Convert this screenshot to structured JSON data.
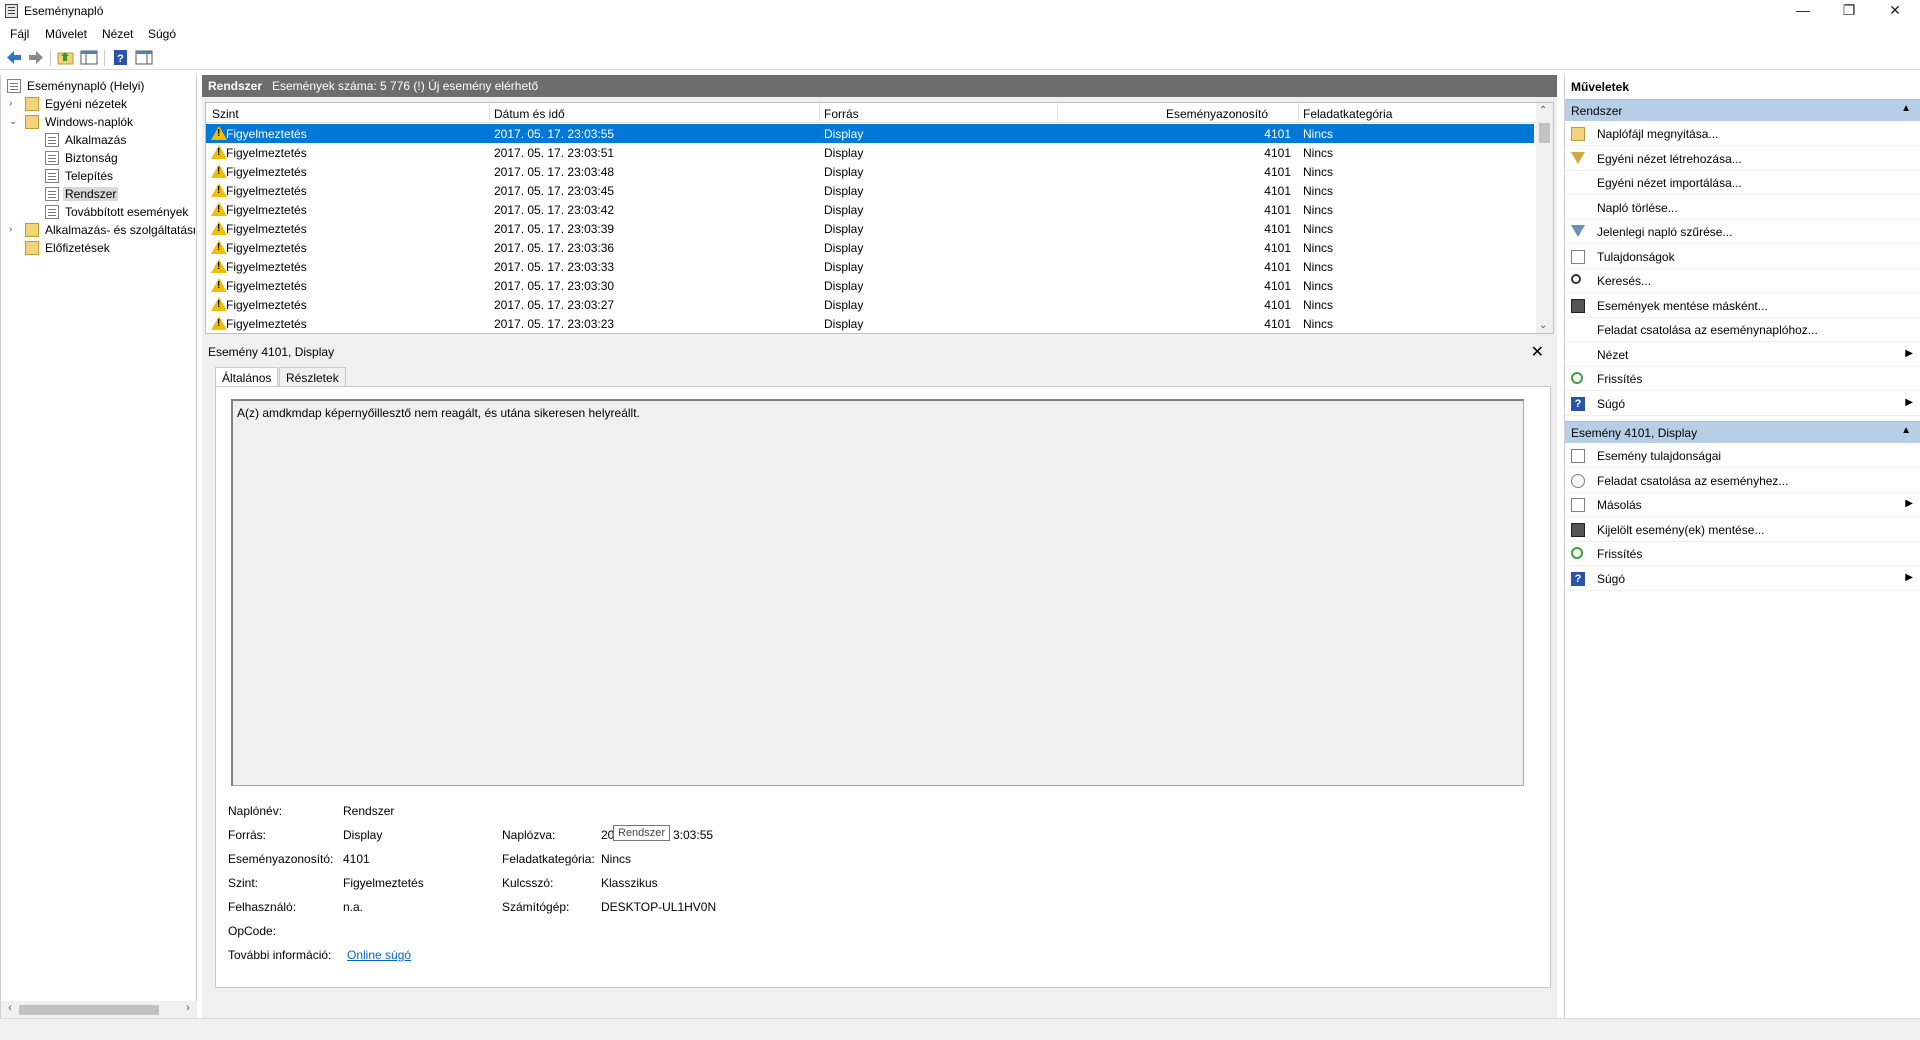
{
  "window": {
    "title": "Eseménynapló",
    "minimize": "—",
    "restore": "❐",
    "close": "✕"
  },
  "menu": {
    "file": "Fájl",
    "action": "Művelet",
    "view": "Nézet",
    "help": "Súgó"
  },
  "tree": {
    "root": "Eseménynapló (Helyi)",
    "custom_views": "Egyéni nézetek",
    "windows_logs": "Windows-naplók",
    "logs": [
      "Alkalmazás",
      "Biztonság",
      "Telepítés",
      "Rendszer",
      "Továbbított események"
    ],
    "app_services": "Alkalmazás- és szolgáltatásn",
    "subscriptions": "Előfizetések"
  },
  "center": {
    "log_name": "Rendszer",
    "count_text": "Események száma: 5 776 (!) Új esemény elérhető"
  },
  "grid": {
    "columns": [
      "Szint",
      "Dátum és idő",
      "Forrás",
      "Eseményazonosító",
      "Feladatkategória"
    ],
    "rows": [
      {
        "level": "Figyelmeztetés",
        "date": "2017. 05. 17. 23:03:55",
        "source": "Display",
        "id": "4101",
        "category": "Nincs"
      },
      {
        "level": "Figyelmeztetés",
        "date": "2017. 05. 17. 23:03:51",
        "source": "Display",
        "id": "4101",
        "category": "Nincs"
      },
      {
        "level": "Figyelmeztetés",
        "date": "2017. 05. 17. 23:03:48",
        "source": "Display",
        "id": "4101",
        "category": "Nincs"
      },
      {
        "level": "Figyelmeztetés",
        "date": "2017. 05. 17. 23:03:45",
        "source": "Display",
        "id": "4101",
        "category": "Nincs"
      },
      {
        "level": "Figyelmeztetés",
        "date": "2017. 05. 17. 23:03:42",
        "source": "Display",
        "id": "4101",
        "category": "Nincs"
      },
      {
        "level": "Figyelmeztetés",
        "date": "2017. 05. 17. 23:03:39",
        "source": "Display",
        "id": "4101",
        "category": "Nincs"
      },
      {
        "level": "Figyelmeztetés",
        "date": "2017. 05. 17. 23:03:36",
        "source": "Display",
        "id": "4101",
        "category": "Nincs"
      },
      {
        "level": "Figyelmeztetés",
        "date": "2017. 05. 17. 23:03:33",
        "source": "Display",
        "id": "4101",
        "category": "Nincs"
      },
      {
        "level": "Figyelmeztetés",
        "date": "2017. 05. 17. 23:03:30",
        "source": "Display",
        "id": "4101",
        "category": "Nincs"
      },
      {
        "level": "Figyelmeztetés",
        "date": "2017. 05. 17. 23:03:27",
        "source": "Display",
        "id": "4101",
        "category": "Nincs"
      },
      {
        "level": "Figyelmeztetés",
        "date": "2017. 05. 17. 23:03:23",
        "source": "Display",
        "id": "4101",
        "category": "Nincs"
      }
    ]
  },
  "detail": {
    "title": "Esemény 4101, Display",
    "tabs": [
      "Általános",
      "Részletek"
    ],
    "description": "A(z) amdkmdap képernyőillesztő nem reagált, és utána sikeresen helyreállt.",
    "labels": {
      "log_name": "Naplónév:",
      "source": "Forrás:",
      "event_id": "Eseményazonosító:",
      "level": "Szint:",
      "user": "Felhasználó:",
      "opcode": "OpCode:",
      "more_info": "További információ:",
      "logged": "Naplózva:",
      "task_category": "Feladatkategória:",
      "keywords": "Kulcsszó:",
      "computer": "Számítógép:"
    },
    "values": {
      "log_name": "Rendszer",
      "source": "Display",
      "event_id": "4101",
      "level": "Figyelmeztetés",
      "user": "n.a.",
      "opcode": "",
      "more_info_link": "Online súgó",
      "logged_prefix": "20",
      "logged_suffix": "3:03:55",
      "task_category": "Nincs",
      "keywords": "Klasszikus",
      "computer": "DESKTOP-UL1HV0N"
    },
    "tooltip": "Rendszer"
  },
  "actions": {
    "title": "Műveletek",
    "section1": "Rendszer",
    "items1": [
      "Naplófájl megnyitása...",
      "Egyéni nézet létrehozása...",
      "Egyéni nézet importálása...",
      "Napló törlése...",
      "Jelenlegi napló szűrése...",
      "Tulajdonságok",
      "Keresés...",
      "Események mentése másként...",
      "Feladat csatolása az eseménynaplóhoz...",
      "Nézet",
      "Frissítés",
      "Súgó"
    ],
    "section2": "Esemény 4101, Display",
    "items2": [
      "Esemény tulajdonságai",
      "Feladat csatolása az eseményhez...",
      "Másolás",
      "Kijelölt esemény(ek) mentése...",
      "Frissítés",
      "Súgó"
    ]
  },
  "colors": {
    "header_gray": "#6d6d6d",
    "selection": "#0078d7",
    "section_blue": "#b7cfe6",
    "link": "#0066cc"
  }
}
